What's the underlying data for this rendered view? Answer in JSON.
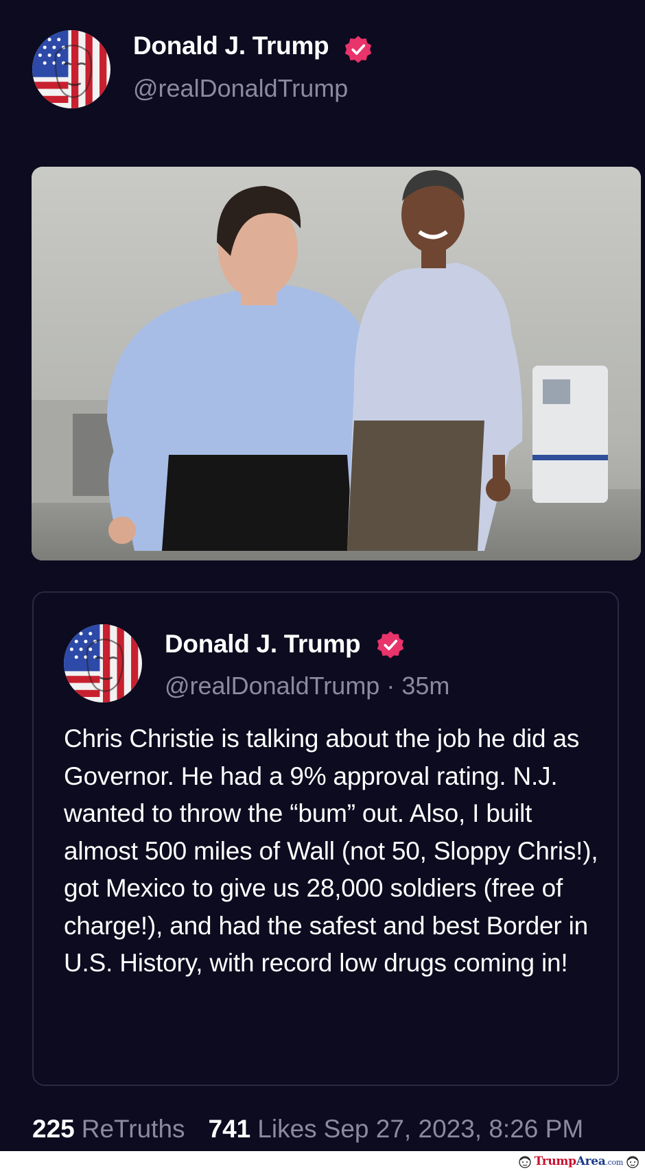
{
  "post": {
    "author": {
      "display_name": "Donald J. Trump",
      "handle": "@realDonaldTrump",
      "verified": true,
      "avatar_icon": "flag-face-avatar-icon"
    },
    "media": {
      "type": "photo",
      "alt_icon": "photo-two-men-walking"
    },
    "quoted_post": {
      "author": {
        "display_name": "Donald J. Trump",
        "handle_time": "@realDonaldTrump · 35m",
        "verified": true
      },
      "text": "Chris Christie is talking about the job he did as Governor. He had a 9% approval rating. N.J. wanted to throw the “bum” out. Also, I built almost 500 miles of Wall (not 50, Sloppy Chris!), got Mexico to give us 28,000 soldiers (free of charge!), and had the safest and best Border in U.S. History, with record low drugs coming in!"
    },
    "stats": {
      "retruths_count": "225",
      "retruths_label": "ReTruths",
      "likes_count": "741",
      "likes_label": "Likes",
      "timestamp": "Sep 27, 2023, 8:26 PM"
    }
  },
  "watermark": {
    "part1": "Trump",
    "part2": "Area",
    "part3": ".com"
  },
  "colors": {
    "background": "#0c0b1f",
    "verified_badge": "#e8336b",
    "muted_text": "#8b8a9e",
    "text": "#ffffff"
  }
}
